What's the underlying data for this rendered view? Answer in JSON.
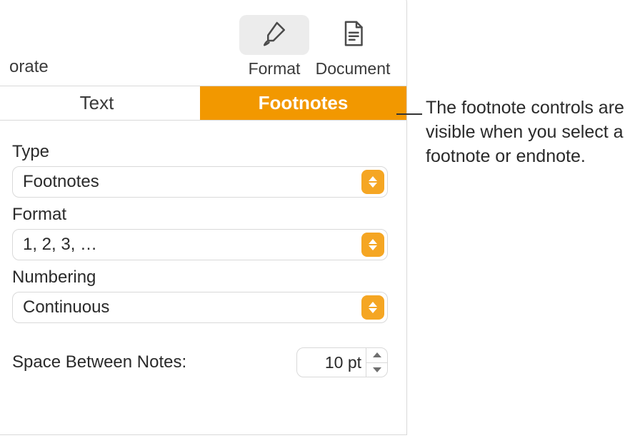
{
  "toolbar": {
    "left_item": "orate",
    "format_label": "Format",
    "document_label": "Document"
  },
  "tabs": {
    "text": "Text",
    "footnotes": "Footnotes"
  },
  "footnotes_pane": {
    "type_label": "Type",
    "type_value": "Footnotes",
    "format_label": "Format",
    "format_value": "1, 2, 3, …",
    "numbering_label": "Numbering",
    "numbering_value": "Continuous",
    "space_label": "Space Between Notes:",
    "space_value": "10 pt"
  },
  "callout": "The footnote controls are visible when you select a footnote or endnote."
}
